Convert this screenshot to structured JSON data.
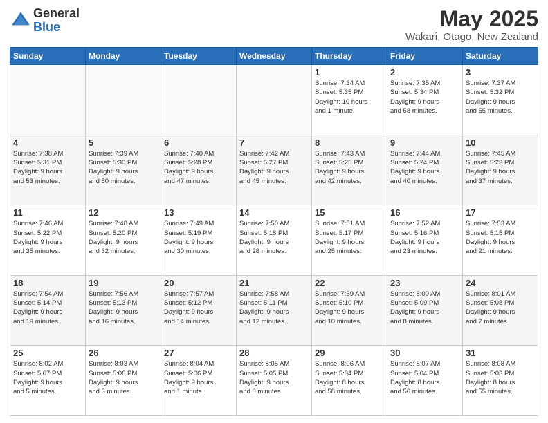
{
  "header": {
    "logo_general": "General",
    "logo_blue": "Blue",
    "month": "May 2025",
    "location": "Wakari, Otago, New Zealand"
  },
  "weekdays": [
    "Sunday",
    "Monday",
    "Tuesday",
    "Wednesday",
    "Thursday",
    "Friday",
    "Saturday"
  ],
  "weeks": [
    [
      {
        "day": "",
        "info": ""
      },
      {
        "day": "",
        "info": ""
      },
      {
        "day": "",
        "info": ""
      },
      {
        "day": "",
        "info": ""
      },
      {
        "day": "1",
        "info": "Sunrise: 7:34 AM\nSunset: 5:35 PM\nDaylight: 10 hours\nand 1 minute."
      },
      {
        "day": "2",
        "info": "Sunrise: 7:35 AM\nSunset: 5:34 PM\nDaylight: 9 hours\nand 58 minutes."
      },
      {
        "day": "3",
        "info": "Sunrise: 7:37 AM\nSunset: 5:32 PM\nDaylight: 9 hours\nand 55 minutes."
      }
    ],
    [
      {
        "day": "4",
        "info": "Sunrise: 7:38 AM\nSunset: 5:31 PM\nDaylight: 9 hours\nand 53 minutes."
      },
      {
        "day": "5",
        "info": "Sunrise: 7:39 AM\nSunset: 5:30 PM\nDaylight: 9 hours\nand 50 minutes."
      },
      {
        "day": "6",
        "info": "Sunrise: 7:40 AM\nSunset: 5:28 PM\nDaylight: 9 hours\nand 47 minutes."
      },
      {
        "day": "7",
        "info": "Sunrise: 7:42 AM\nSunset: 5:27 PM\nDaylight: 9 hours\nand 45 minutes."
      },
      {
        "day": "8",
        "info": "Sunrise: 7:43 AM\nSunset: 5:25 PM\nDaylight: 9 hours\nand 42 minutes."
      },
      {
        "day": "9",
        "info": "Sunrise: 7:44 AM\nSunset: 5:24 PM\nDaylight: 9 hours\nand 40 minutes."
      },
      {
        "day": "10",
        "info": "Sunrise: 7:45 AM\nSunset: 5:23 PM\nDaylight: 9 hours\nand 37 minutes."
      }
    ],
    [
      {
        "day": "11",
        "info": "Sunrise: 7:46 AM\nSunset: 5:22 PM\nDaylight: 9 hours\nand 35 minutes."
      },
      {
        "day": "12",
        "info": "Sunrise: 7:48 AM\nSunset: 5:20 PM\nDaylight: 9 hours\nand 32 minutes."
      },
      {
        "day": "13",
        "info": "Sunrise: 7:49 AM\nSunset: 5:19 PM\nDaylight: 9 hours\nand 30 minutes."
      },
      {
        "day": "14",
        "info": "Sunrise: 7:50 AM\nSunset: 5:18 PM\nDaylight: 9 hours\nand 28 minutes."
      },
      {
        "day": "15",
        "info": "Sunrise: 7:51 AM\nSunset: 5:17 PM\nDaylight: 9 hours\nand 25 minutes."
      },
      {
        "day": "16",
        "info": "Sunrise: 7:52 AM\nSunset: 5:16 PM\nDaylight: 9 hours\nand 23 minutes."
      },
      {
        "day": "17",
        "info": "Sunrise: 7:53 AM\nSunset: 5:15 PM\nDaylight: 9 hours\nand 21 minutes."
      }
    ],
    [
      {
        "day": "18",
        "info": "Sunrise: 7:54 AM\nSunset: 5:14 PM\nDaylight: 9 hours\nand 19 minutes."
      },
      {
        "day": "19",
        "info": "Sunrise: 7:56 AM\nSunset: 5:13 PM\nDaylight: 9 hours\nand 16 minutes."
      },
      {
        "day": "20",
        "info": "Sunrise: 7:57 AM\nSunset: 5:12 PM\nDaylight: 9 hours\nand 14 minutes."
      },
      {
        "day": "21",
        "info": "Sunrise: 7:58 AM\nSunset: 5:11 PM\nDaylight: 9 hours\nand 12 minutes."
      },
      {
        "day": "22",
        "info": "Sunrise: 7:59 AM\nSunset: 5:10 PM\nDaylight: 9 hours\nand 10 minutes."
      },
      {
        "day": "23",
        "info": "Sunrise: 8:00 AM\nSunset: 5:09 PM\nDaylight: 9 hours\nand 8 minutes."
      },
      {
        "day": "24",
        "info": "Sunrise: 8:01 AM\nSunset: 5:08 PM\nDaylight: 9 hours\nand 7 minutes."
      }
    ],
    [
      {
        "day": "25",
        "info": "Sunrise: 8:02 AM\nSunset: 5:07 PM\nDaylight: 9 hours\nand 5 minutes."
      },
      {
        "day": "26",
        "info": "Sunrise: 8:03 AM\nSunset: 5:06 PM\nDaylight: 9 hours\nand 3 minutes."
      },
      {
        "day": "27",
        "info": "Sunrise: 8:04 AM\nSunset: 5:06 PM\nDaylight: 9 hours\nand 1 minute."
      },
      {
        "day": "28",
        "info": "Sunrise: 8:05 AM\nSunset: 5:05 PM\nDaylight: 9 hours\nand 0 minutes."
      },
      {
        "day": "29",
        "info": "Sunrise: 8:06 AM\nSunset: 5:04 PM\nDaylight: 8 hours\nand 58 minutes."
      },
      {
        "day": "30",
        "info": "Sunrise: 8:07 AM\nSunset: 5:04 PM\nDaylight: 8 hours\nand 56 minutes."
      },
      {
        "day": "31",
        "info": "Sunrise: 8:08 AM\nSunset: 5:03 PM\nDaylight: 8 hours\nand 55 minutes."
      }
    ]
  ]
}
